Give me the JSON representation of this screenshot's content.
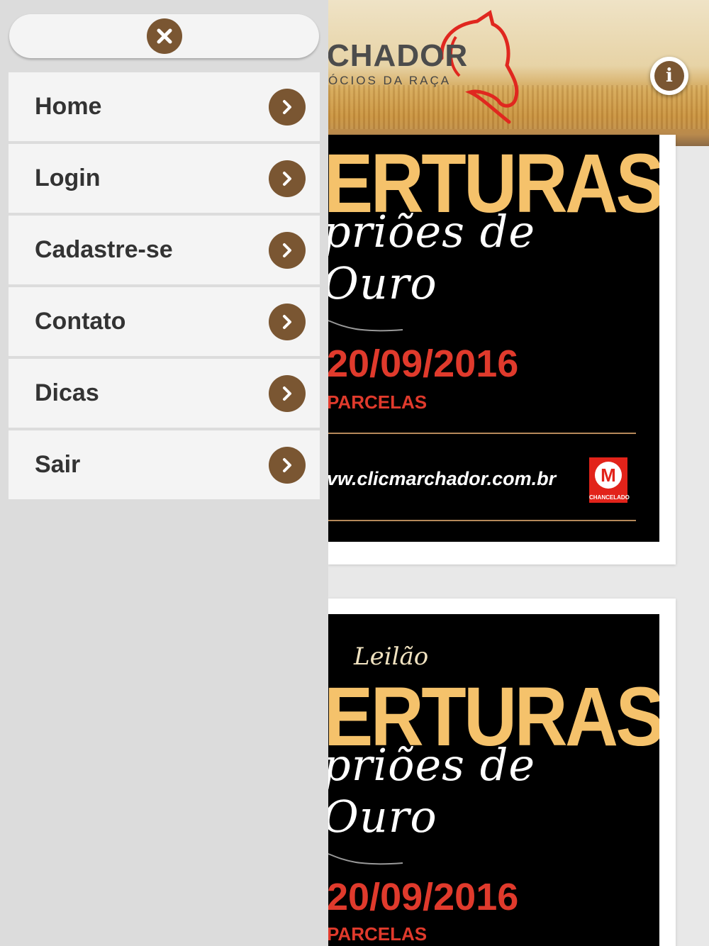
{
  "header": {
    "brand_text": "CHADOR",
    "brand_sub": "ÓCIOS DA RAÇA",
    "info_icon": "i"
  },
  "menu": {
    "close_icon": "close-icon",
    "items": [
      {
        "label": "Home"
      },
      {
        "label": "Login"
      },
      {
        "label": "Cadastre-se"
      },
      {
        "label": "Contato"
      },
      {
        "label": "Dicas"
      },
      {
        "label": "Sair"
      }
    ]
  },
  "posters": [
    {
      "title": "ERTURAS",
      "subtitle": "priões de Ouro",
      "date": "20/09/2016",
      "parcelas": "PARCELAS",
      "url": "vw.clicmarchador.com.br",
      "badge_label": "CHANCELADO"
    },
    {
      "leilao": "Leilão",
      "title": "ERTURAS",
      "subtitle": "priões de Ouro",
      "date": "20/09/2016",
      "parcelas": "PARCELAS"
    }
  ],
  "colors": {
    "accent_brown": "#7a5632",
    "poster_gold": "#f5c26b",
    "poster_red": "#e03a2c",
    "menu_bg": "#f4f4f4"
  }
}
